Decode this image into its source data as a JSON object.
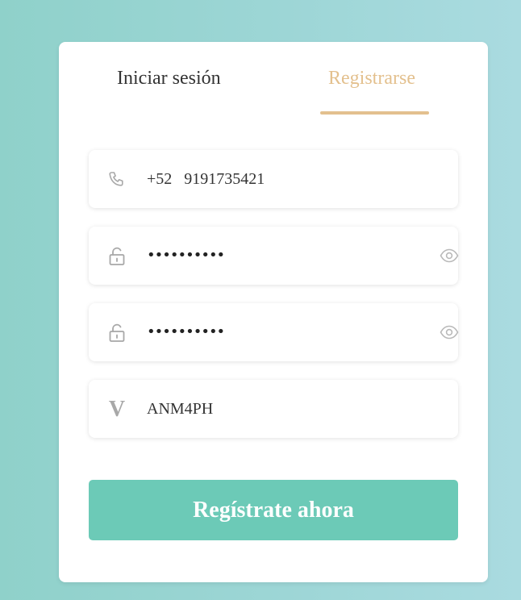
{
  "tabs": {
    "login_label": "Iniciar sesión",
    "register_label": "Registrarse",
    "active": "register"
  },
  "form": {
    "phone": {
      "country_code": "+52",
      "number": "9191735421",
      "icon": "phone-icon"
    },
    "password": {
      "masked_value": "••••••••••",
      "icon": "lock-icon",
      "toggle_icon": "eye-icon"
    },
    "confirm_password": {
      "masked_value": "••••••••••",
      "icon": "lock-icon",
      "toggle_icon": "eye-icon"
    },
    "invite_code": {
      "value": "ANM4PH",
      "icon_glyph": "V"
    },
    "submit_label": "Regístrate ahora"
  },
  "colors": {
    "accent_gold": "#e3c08e",
    "button_teal": "#6ccab7",
    "icon_gray": "#a8a8a8"
  }
}
